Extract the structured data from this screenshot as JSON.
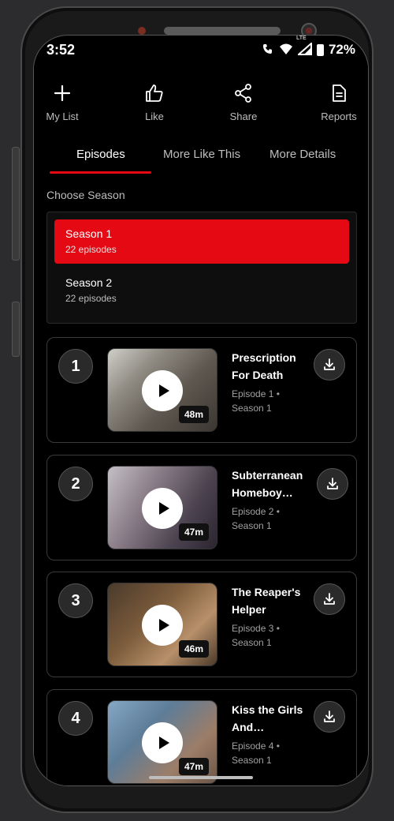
{
  "status_bar": {
    "time": "3:52",
    "battery_pct": "72%",
    "net_label": "LTE"
  },
  "actions": [
    {
      "label": "My List",
      "icon": "plus-icon"
    },
    {
      "label": "Like",
      "icon": "thumbs-up-icon"
    },
    {
      "label": "Share",
      "icon": "share-icon"
    },
    {
      "label": "Reports",
      "icon": "document-icon"
    }
  ],
  "tabs": [
    {
      "label": "Episodes",
      "active": true
    },
    {
      "label": "More Like This",
      "active": false
    },
    {
      "label": "More Details",
      "active": false
    }
  ],
  "choose_season_label": "Choose Season",
  "seasons": [
    {
      "name": "Season 1",
      "count": "22 episodes",
      "selected": true
    },
    {
      "name": "Season 2",
      "count": "22 episodes",
      "selected": false
    }
  ],
  "episodes": [
    {
      "number": "1",
      "title": "Prescription For Death",
      "episode_label": "Episode 1 •",
      "season_label": "Season 1",
      "duration": "48m"
    },
    {
      "number": "2",
      "title": "Subterranean Homeboy…",
      "episode_label": "Episode 2 •",
      "season_label": "Season 1",
      "duration": "47m"
    },
    {
      "number": "3",
      "title": "The Reaper's Helper",
      "episode_label": "Episode 3 •",
      "season_label": "Season 1",
      "duration": "46m"
    },
    {
      "number": "4",
      "title": "Kiss the Girls And…",
      "episode_label": "Episode 4 •",
      "season_label": "Season 1",
      "duration": "47m"
    }
  ],
  "colors": {
    "accent": "#e50914",
    "background": "#000000",
    "card_border": "#3a3a3a"
  }
}
